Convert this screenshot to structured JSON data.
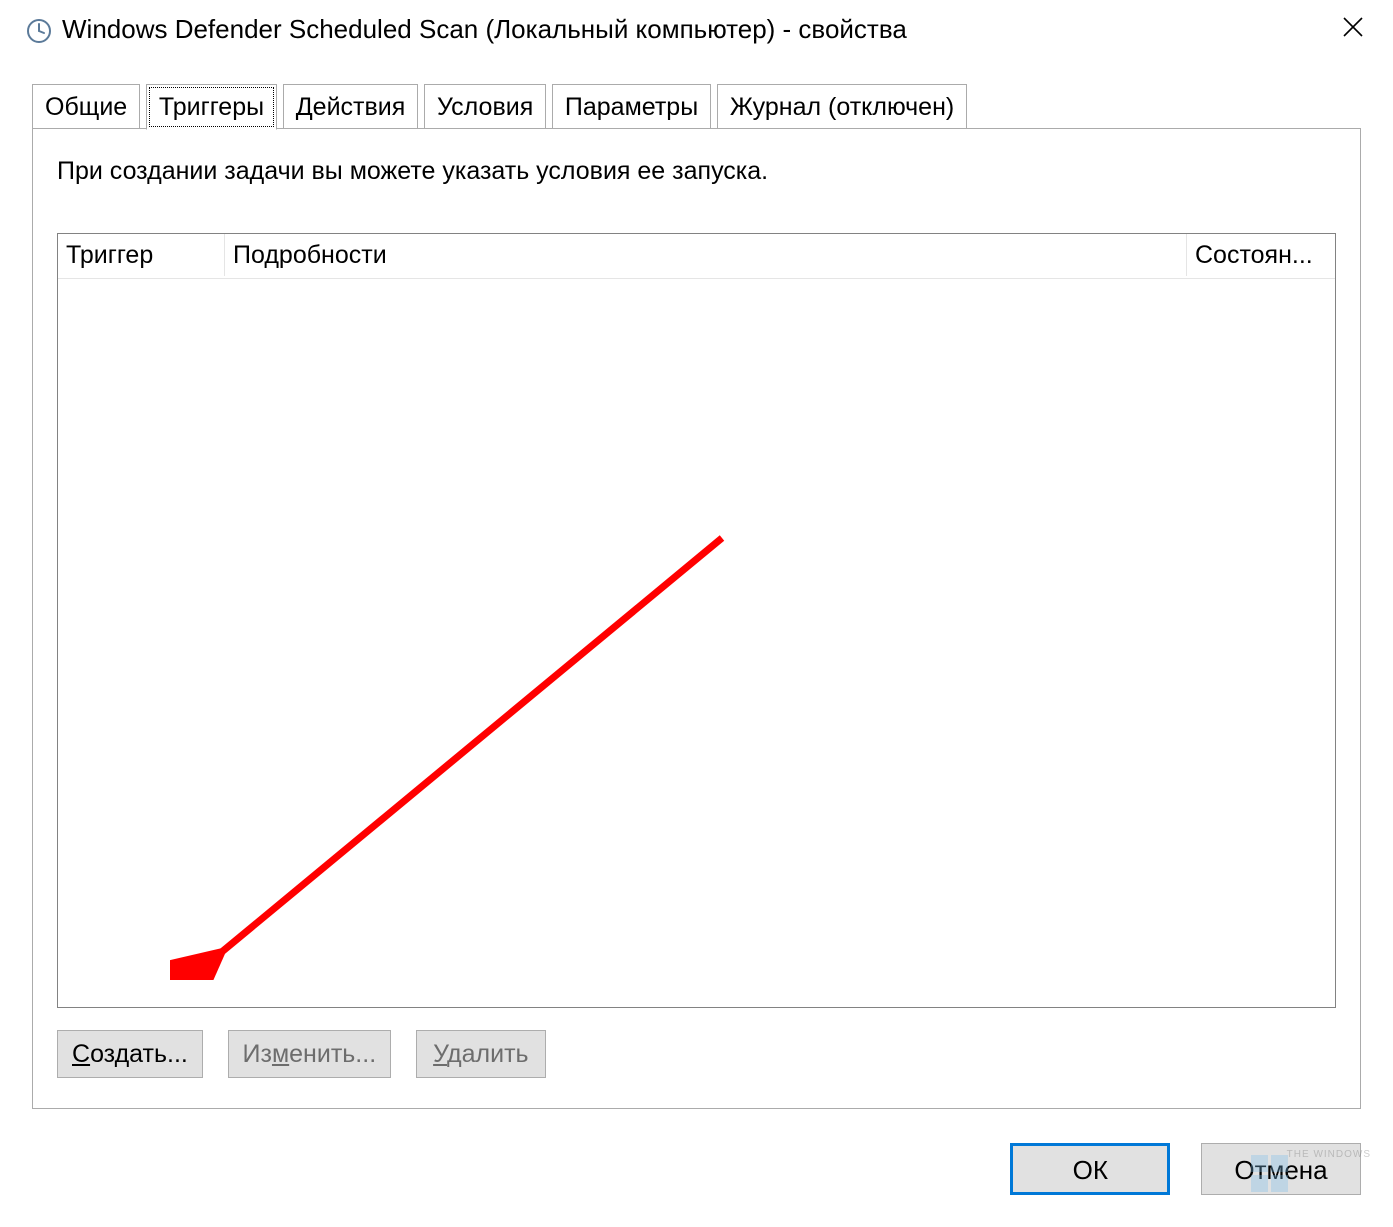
{
  "titlebar": {
    "title": "Windows Defender Scheduled Scan (Локальный компьютер) - свойства"
  },
  "tabs": [
    {
      "label": "Общие"
    },
    {
      "label": "Триггеры"
    },
    {
      "label": "Действия"
    },
    {
      "label": "Условия"
    },
    {
      "label": "Параметры"
    },
    {
      "label": "Журнал (отключен)"
    }
  ],
  "triggers": {
    "description": "При создании задачи вы можете указать условия ее запуска.",
    "columns": {
      "trigger": "Триггер",
      "details": "Подробности",
      "status": "Состоян..."
    },
    "buttons": {
      "new": "Создать...",
      "edit": "Изменить...",
      "delete": "Удалить"
    }
  },
  "dialog": {
    "ok": "ОК",
    "cancel": "Отмена"
  },
  "watermark": "THE WINDOWS"
}
